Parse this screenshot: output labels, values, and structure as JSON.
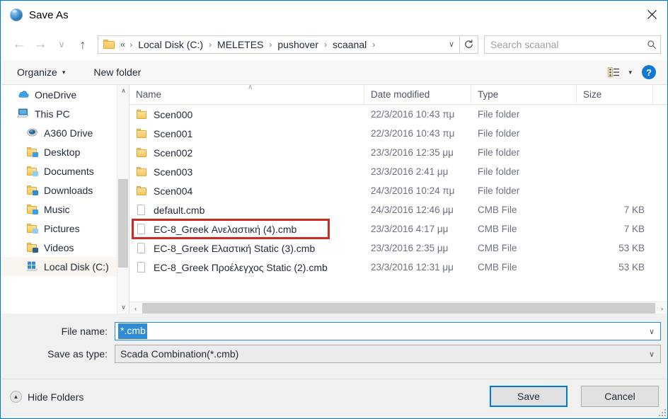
{
  "window": {
    "title": "Save As",
    "app_icon": "globe-icon",
    "close_label": "✕"
  },
  "nav": {
    "back_icon": "←",
    "forward_icon": "→",
    "recent_icon": "∨",
    "up_icon": "↑",
    "dropdown_icon": "∨",
    "refresh_icon": "↻"
  },
  "address": {
    "prefix": "«",
    "crumbs": [
      "Local Disk (C:)",
      "MELETES",
      "pushover",
      "scaanal"
    ],
    "separator": "›"
  },
  "search": {
    "placeholder": "Search scaanal",
    "value": ""
  },
  "commandbar": {
    "organize_label": "Organize",
    "organize_caret": "▾",
    "new_folder_label": "New folder",
    "view_caret": "▾",
    "help_label": "?"
  },
  "sidebar": {
    "items": [
      {
        "label": "OneDrive",
        "icon": "onedrive-icon",
        "indent": false,
        "selected": false
      },
      {
        "label": "This PC",
        "icon": "this-pc-icon",
        "indent": false,
        "selected": false
      },
      {
        "label": "A360 Drive",
        "icon": "a360-drive-icon",
        "indent": true,
        "selected": false
      },
      {
        "label": "Desktop",
        "icon": "desktop-folder-icon",
        "indent": true,
        "selected": false
      },
      {
        "label": "Documents",
        "icon": "documents-folder-icon",
        "indent": true,
        "selected": false
      },
      {
        "label": "Downloads",
        "icon": "downloads-folder-icon",
        "indent": true,
        "selected": false
      },
      {
        "label": "Music",
        "icon": "music-folder-icon",
        "indent": true,
        "selected": false
      },
      {
        "label": "Pictures",
        "icon": "pictures-folder-icon",
        "indent": true,
        "selected": false
      },
      {
        "label": "Videos",
        "icon": "videos-folder-icon",
        "indent": true,
        "selected": false
      },
      {
        "label": "Local Disk (C:)",
        "icon": "local-disk-icon",
        "indent": true,
        "selected": true
      }
    ],
    "scroll_up_icon": "∧",
    "scroll_down_icon": "∨"
  },
  "filelist": {
    "columns": [
      {
        "key": "name",
        "label": "Name"
      },
      {
        "key": "date",
        "label": "Date modified"
      },
      {
        "key": "type",
        "label": "Type"
      },
      {
        "key": "size",
        "label": "Size"
      }
    ],
    "sort_indicator": "∧",
    "rows": [
      {
        "name": "Scen000",
        "date": "22/3/2016 10:43 πμ",
        "type": "File folder",
        "size": "",
        "icon": "folder-icon",
        "highlighted": false
      },
      {
        "name": "Scen001",
        "date": "22/3/2016 10:43 πμ",
        "type": "File folder",
        "size": "",
        "icon": "folder-icon",
        "highlighted": false
      },
      {
        "name": "Scen002",
        "date": "23/3/2016 12:35 μμ",
        "type": "File folder",
        "size": "",
        "icon": "folder-icon",
        "highlighted": false
      },
      {
        "name": "Scen003",
        "date": "23/3/2016 2:41 μμ",
        "type": "File folder",
        "size": "",
        "icon": "folder-icon",
        "highlighted": false
      },
      {
        "name": "Scen004",
        "date": "24/3/2016 10:24 πμ",
        "type": "File folder",
        "size": "",
        "icon": "folder-icon",
        "highlighted": false
      },
      {
        "name": "default.cmb",
        "date": "24/3/2016 12:46 μμ",
        "type": "CMB File",
        "size": "7 KB",
        "icon": "document-icon",
        "highlighted": false
      },
      {
        "name": "EC-8_Greek Ανελαστική (4).cmb",
        "date": "23/3/2016 4:17 μμ",
        "type": "CMB File",
        "size": "7 KB",
        "icon": "document-icon",
        "highlighted": true
      },
      {
        "name": "EC-8_Greek Ελαστική Static (3).cmb",
        "date": "23/3/2016 2:35 μμ",
        "type": "CMB File",
        "size": "53 KB",
        "icon": "document-icon",
        "highlighted": false
      },
      {
        "name": "EC-8_Greek Προέλεγχος Static (2).cmb",
        "date": "23/3/2016 12:31 μμ",
        "type": "CMB File",
        "size": "53 KB",
        "icon": "document-icon",
        "highlighted": false
      }
    ],
    "hscroll_left_icon": "‹",
    "hscroll_right_icon": "›"
  },
  "form": {
    "filename_label": "File name:",
    "filename_value": "*.cmb",
    "savetype_label": "Save as type:",
    "savetype_value": "Scada Combination(*.cmb)",
    "combo_caret": "∨"
  },
  "footer": {
    "hide_folders_label": "Hide Folders",
    "hide_folders_icon": "▲",
    "save_label": "Save",
    "cancel_label": "Cancel"
  },
  "colors": {
    "accent": "#0078d7",
    "highlight_box": "#cc2a23",
    "selection": "#2f8bd4"
  }
}
